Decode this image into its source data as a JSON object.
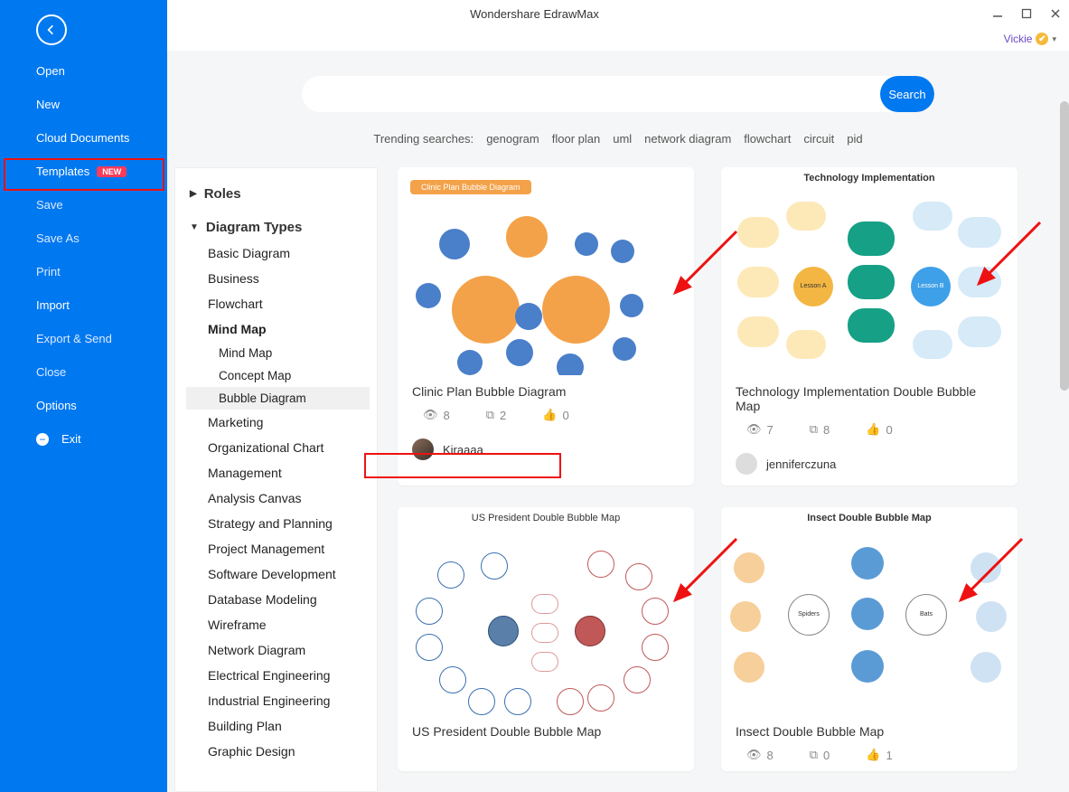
{
  "window_title": "Wondershare EdrawMax",
  "user": {
    "name": "Vickie"
  },
  "sidebar": {
    "items": [
      {
        "label": "Open",
        "bold": true
      },
      {
        "label": "New",
        "bold": true
      },
      {
        "label": "Cloud Documents",
        "bold": true
      },
      {
        "label": "Templates",
        "bold": true,
        "badge": "NEW",
        "selected": true
      },
      {
        "label": "Save"
      },
      {
        "label": "Save As"
      },
      {
        "label": "Print"
      },
      {
        "label": "Import",
        "bold": true
      },
      {
        "label": "Export & Send"
      },
      {
        "label": "Close"
      },
      {
        "label": "Options",
        "bold": true
      },
      {
        "label": "Exit",
        "icon": "minus",
        "bold": true
      }
    ]
  },
  "search": {
    "button_label": "Search",
    "placeholder": "",
    "trending_label": "Trending searches:",
    "trending": [
      "genogram",
      "floor plan",
      "uml",
      "network diagram",
      "flowchart",
      "circuit",
      "pid"
    ]
  },
  "categories": {
    "roles_label": "Roles",
    "types_label": "Diagram Types",
    "types": [
      "Basic Diagram",
      "Business",
      "Flowchart"
    ],
    "mind_map": {
      "label": "Mind Map",
      "children": [
        "Mind Map",
        "Concept Map",
        "Bubble Diagram"
      ]
    },
    "rest": [
      "Marketing",
      "Organizational Chart",
      "Management",
      "Analysis Canvas",
      "Strategy and Planning",
      "Project Management",
      "Software Development",
      "Database Modeling",
      "Wireframe",
      "Network Diagram",
      "Electrical Engineering",
      "Industrial Engineering",
      "Building Plan",
      "Graphic Design"
    ]
  },
  "cards": [
    {
      "title": "Clinic Plan Bubble Diagram",
      "views": "8",
      "copies": "2",
      "likes": "0",
      "author": "Kiraaaa",
      "thumb_label": "Clinic Plan Bubble Diagram",
      "thumb_style": "clinic"
    },
    {
      "title": "Technology Implementation Double Bubble Map",
      "views": "7",
      "copies": "8",
      "likes": "0",
      "author": "jenniferczuna",
      "thumb_label": "Technology Implementation",
      "thumb_style": "tech"
    },
    {
      "title": "US President Double Bubble Map",
      "views": "",
      "copies": "",
      "likes": "",
      "author": "",
      "thumb_label": "US President Double Bubble Map",
      "thumb_style": "president"
    },
    {
      "title": "Insect Double Bubble Map",
      "views": "8",
      "copies": "0",
      "likes": "1",
      "author": "",
      "thumb_label": "Insect Double Bubble Map",
      "thumb_style": "insect"
    }
  ]
}
